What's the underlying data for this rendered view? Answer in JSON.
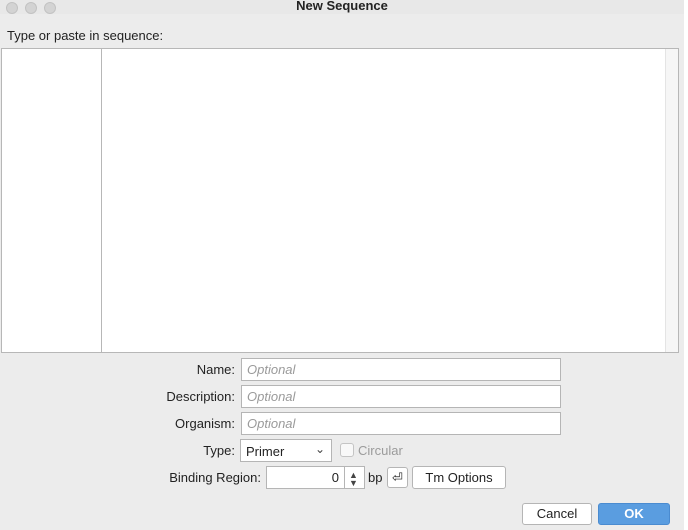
{
  "window": {
    "title": "New Sequence"
  },
  "prompt": "Type or paste in sequence:",
  "form": {
    "name_label": "Name:",
    "name_placeholder": "Optional",
    "description_label": "Description:",
    "description_placeholder": "Optional",
    "organism_label": "Organism:",
    "organism_placeholder": "Optional",
    "type_label": "Type:",
    "type_value": "Primer",
    "circular_label": "Circular",
    "circular_checked": false,
    "binding_label": "Binding Region:",
    "binding_value": "0",
    "binding_unit": "bp",
    "enter_symbol": "⏎",
    "tm_options_label": "Tm Options"
  },
  "footer": {
    "cancel_label": "Cancel",
    "ok_label": "OK"
  },
  "colors": {
    "ok_button": "#5a9de0",
    "dialog_bg": "#ececec"
  },
  "icons": {
    "select_chevron": "chevron-down-icon",
    "stepper": "stepper-icon",
    "enter": "return-icon"
  }
}
